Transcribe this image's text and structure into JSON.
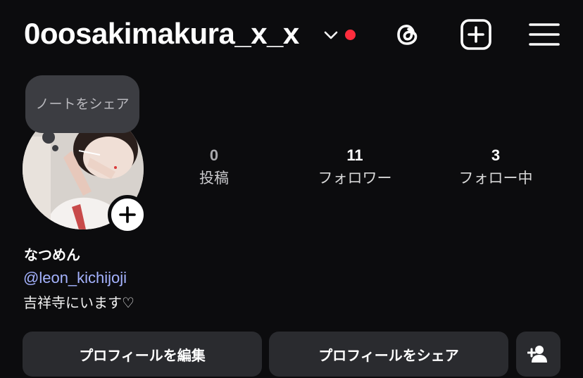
{
  "header": {
    "username": "0oosakimakura_x_x",
    "notification_color": "#ff2d3d"
  },
  "note": {
    "text": "ノートをシェア"
  },
  "stats": {
    "posts": {
      "count": "0",
      "label": "投稿"
    },
    "followers": {
      "count": "11",
      "label": "フォロワー"
    },
    "following": {
      "count": "3",
      "label": "フォロー中"
    }
  },
  "profile": {
    "display_name": "なつめん",
    "threads_handle": "@leon_kichijoji",
    "bio": "吉祥寺にいます♡"
  },
  "buttons": {
    "edit_profile": "プロフィールを編集",
    "share_profile": "プロフィールをシェア"
  },
  "icons": {
    "chevron": "chevron-down-icon",
    "threads": "threads-icon",
    "create": "add-square-icon",
    "menu": "hamburger-menu-icon",
    "avatar_add": "plus-icon",
    "discover_people": "add-person-icon"
  },
  "colors": {
    "background": "#0c0c0e",
    "button_bg": "#2a2b2f",
    "link": "#a5b3ff",
    "note_bg": "#3c3d42"
  }
}
